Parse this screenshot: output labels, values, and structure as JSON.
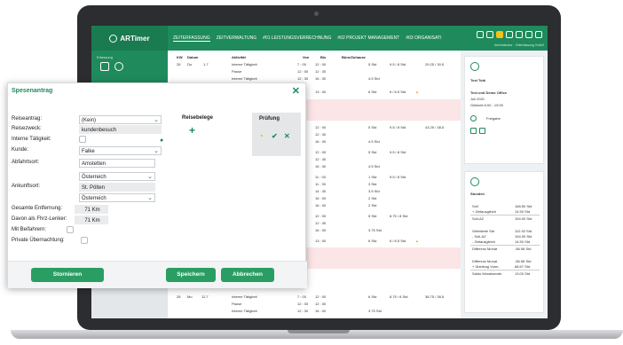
{
  "app": {
    "logo_text": "ARTimer",
    "nav": [
      "ZEITERFASSUNG",
      "ZEITVERWALTUNG",
      "#01 LEISTUNGSVERRECHNUNG",
      "#02 PROJEKT MANAGEMENT",
      "#03 ORGANISATI"
    ],
    "header_sub": "Administrator · Zeiterfassung GmbH",
    "rail_label": "Erfassung"
  },
  "table": {
    "headers": {
      "kw": "KW",
      "datum": "Datum",
      "aktivitaet": "Aktivität",
      "von": "Von",
      "bis": "Bis",
      "buero": "Büro/Zuhause"
    },
    "rows_top": [
      {
        "kw": "26",
        "day": "Do",
        "date": "1.7",
        "activity": "Interne Tätigkeit",
        "von": "7 : 00",
        "bis": "12 : 00",
        "dur": "5 Std",
        "bal": "9.5 / 8 Std",
        "tot": "29.25 / 30.5"
      },
      {
        "activity": "Pause",
        "von": "12 : 00",
        "bis": "12 : 30"
      },
      {
        "activity": "Interne Tätigkeit",
        "von": "12 : 30",
        "bis": "16 : 30",
        "dur": "4.5 Std"
      }
    ],
    "behind": [
      {
        "von": "13 : 00",
        "dur": "6 Std",
        "bal": "6 / 6.5 Std"
      },
      {
        "bis": "12 : 00",
        "dur": "5 Std",
        "bal": "9.5 / 8 Std",
        "tot": "43.25 / 38.5"
      },
      {
        "bis": "12 : 30"
      },
      {
        "bis": "16 : 30",
        "dur": "4.5 Std"
      },
      {
        "bis": "12 : 00",
        "dur": "5 Std",
        "bal": "9.5 / 8 Std"
      },
      {
        "bis": "12 : 30"
      },
      {
        "bis": "16 : 30",
        "dur": "4.5 Std"
      },
      {
        "bis": "11 : 00",
        "dur": "1 Std",
        "bal": "9.5 / 8 Std"
      },
      {
        "bis": "11 : 30",
        "dur": "3 Std"
      },
      {
        "bis": "14 : 30",
        "dur": "3.5 Std"
      },
      {
        "bis": "16 : 00",
        "dur": "2 Std"
      },
      {
        "bis": "16 : 00",
        "dur": "2 Std"
      },
      {
        "bis": "12 : 00",
        "dur": "5 Std",
        "bal": "8.75 / 8 Std"
      },
      {
        "bis": "12 : 30"
      },
      {
        "bis": "16 : 00",
        "dur": "3.75 Std"
      },
      {
        "bis": "13 : 00",
        "dur": "6 Std",
        "bal": "6 / 6.5 Std"
      }
    ],
    "rows_bottom": [
      {
        "kw": "28",
        "day": "Mo",
        "date": "12.7",
        "activity": "Interne Tätigkeit",
        "von": "7 : 00",
        "bis": "12 : 00",
        "dur": "6 Std",
        "bal": "8.75 / 8 Std",
        "tot": "38.75 / 38.5"
      },
      {
        "activity": "Pause",
        "von": "12 : 00",
        "bis": "12 : 30"
      },
      {
        "activity": "Interne Tätigkeit",
        "von": "12 : 30",
        "bis": "16 : 00",
        "dur": "3.75 Std"
      }
    ]
  },
  "right_panel": {
    "user": "Test Tobi",
    "office": "Test und Demo Office",
    "period": "Juli 2021",
    "shift": "Gleitzeit 6:00 - 19:00",
    "release": "Freigabe",
    "hours_title": "Stunden",
    "stats": [
      {
        "label": "Soll",
        "value": "168.50 Std"
      },
      {
        "label": "+ Zeitausgleich",
        "value": "14.50 Std"
      },
      {
        "label": "Soll-AZ",
        "value": "154.00 Std"
      },
      {
        "label": "Geleistete Std",
        "value": "112.92 Std"
      },
      {
        "label": "- Soll-AZ",
        "value": "154.00 Std"
      },
      {
        "label": "- Zeitausgleich",
        "value": "14.50 Std"
      },
      {
        "label": "Differenz Monat",
        "value": "-56.58 Std"
      },
      {
        "label": "Differenz Monat",
        "value": "-56.58 Std"
      },
      {
        "label": "+ Übertrag Vorm.",
        "value": "68.67 Std"
      },
      {
        "label": "Saldo Monatsende",
        "value": "13.00 Std"
      }
    ]
  },
  "dialog": {
    "title": "Spesenantrag",
    "close": "✕",
    "fields": {
      "reiseantrag": {
        "label": "Reiseantrag:",
        "value": "(Kein)"
      },
      "reisezweck": {
        "label": "Reisezweck:",
        "value": "kundenbesuch"
      },
      "interne": {
        "label": "Interne Tätigkeit:"
      },
      "kunde": {
        "label": "Kunde:",
        "value": "Falke"
      },
      "abfahrtsort": {
        "label": "Abfahrtsort:",
        "value": "Amstetten",
        "country": "Österreich"
      },
      "ankunftsort": {
        "label": "Ankunftsort:",
        "value": "St. Pölten",
        "country": "Österreich"
      },
      "entfernung": {
        "label": "Gesamte Entfernung:",
        "value": "71 Km"
      },
      "fhrz": {
        "label": "Davon als Fhrz-Lenker:",
        "value": "71 Km"
      },
      "beifahrern": {
        "label": "Mit Beifahrern:"
      },
      "privat": {
        "label": "Private Übernachtung:"
      }
    },
    "reisebelege": "Reisebelege",
    "pruefung": "Prüfung",
    "buttons": {
      "stornieren": "Stornieren",
      "speichern": "Speichern",
      "abbrechen": "Abbrechen"
    }
  },
  "colors": {
    "brand": "#1f8a5b",
    "button": "#2a9d63",
    "warning": "#e8a21a"
  }
}
